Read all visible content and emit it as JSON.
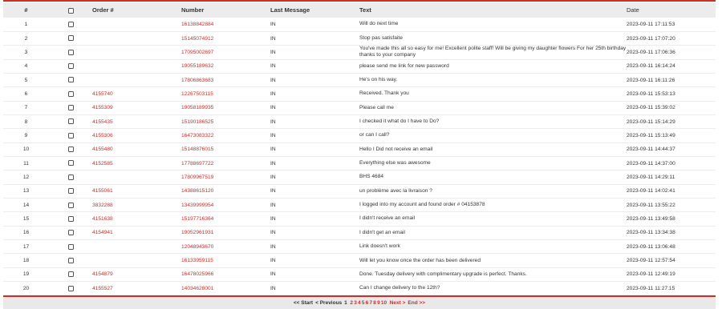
{
  "columns": {
    "num": "#",
    "order": "Order #",
    "number": "Number",
    "last_message": "Last Message",
    "text": "Text",
    "date": "Date"
  },
  "rows": [
    {
      "num": "1",
      "order": "",
      "number": "16138842884",
      "last": "IN",
      "text": "Will do next time",
      "date": "2023-09-11 17:11:53"
    },
    {
      "num": "2",
      "order": "",
      "number": "15145074912",
      "last": "IN",
      "text": "Stop pas satisfaite",
      "date": "2023-09-11 17:07:20"
    },
    {
      "num": "3",
      "order": "",
      "number": "17095002697",
      "last": "IN",
      "text": "You've made this all so easy for me! Excellent polite staff! Will be giving my daughter flowers For her 25th birthday thanks to your company",
      "date": "2023-09-11 17:06:36"
    },
    {
      "num": "4",
      "order": "",
      "number": "19055189632",
      "last": "IN",
      "text": "please send me link for new password",
      "date": "2023-09-11 16:14:24"
    },
    {
      "num": "5",
      "order": "",
      "number": "17806863683",
      "last": "IN",
      "text": "He's on his way.",
      "date": "2023-09-11 16:11:26"
    },
    {
      "num": "6",
      "order": "4155740",
      "number": "12267503115",
      "last": "IN",
      "text": "Received. Thank you",
      "date": "2023-09-11 15:53:13"
    },
    {
      "num": "7",
      "order": "4155309",
      "number": "19058189935",
      "last": "IN",
      "text": "Please call me",
      "date": "2023-09-11 15:39:02"
    },
    {
      "num": "8",
      "order": "4155435",
      "number": "15190186525",
      "last": "IN",
      "text": "I checked it what do I have to Do?",
      "date": "2023-09-11 15:14:29"
    },
    {
      "num": "9",
      "order": "4155306",
      "number": "16473083322",
      "last": "IN",
      "text": "or can I call?",
      "date": "2023-09-11 15:13:49"
    },
    {
      "num": "10",
      "order": "4155480",
      "number": "15148876015",
      "last": "IN",
      "text": "Hello I Did not receive an email",
      "date": "2023-09-11 14:44:37"
    },
    {
      "num": "11",
      "order": "4152585",
      "number": "17788697722",
      "last": "IN",
      "text": "Everything else was awesome",
      "date": "2023-09-11 14:37:00"
    },
    {
      "num": "12",
      "order": "",
      "number": "17809967519",
      "last": "IN",
      "text": "BHS 4684",
      "date": "2023-09-11 14:29:11"
    },
    {
      "num": "13",
      "order": "4155061",
      "number": "14388615120",
      "last": "IN",
      "text": "un problème avec la livraison ?",
      "date": "2023-09-11 14:02:41"
    },
    {
      "num": "14",
      "order": "3832288",
      "number": "13439999954",
      "last": "IN",
      "text": "I logged into my account and found order # 04153878",
      "date": "2023-09-11 13:55:22"
    },
    {
      "num": "15",
      "order": "4151638",
      "number": "15197716364",
      "last": "IN",
      "text": "I didn't receive an email",
      "date": "2023-09-11 13:49:58"
    },
    {
      "num": "16",
      "order": "4154941",
      "number": "19052961931",
      "last": "IN",
      "text": "I didn't get an email",
      "date": "2023-09-11 13:34:38"
    },
    {
      "num": "17",
      "order": "",
      "number": "12048943670",
      "last": "IN",
      "text": "Link doesn't work",
      "date": "2023-09-11 13:06:48"
    },
    {
      "num": "18",
      "order": "",
      "number": "16133959115",
      "last": "IN",
      "text": "Will let you know once the order has been delivered",
      "date": "2023-09-11 12:57:54"
    },
    {
      "num": "19",
      "order": "4154879",
      "number": "16478025966",
      "last": "IN",
      "text": "Done. Tuesday delivery with complimentary upgrade is perfect. Thanks.",
      "date": "2023-09-11 12:49:19"
    },
    {
      "num": "20",
      "order": "4155527",
      "number": "14034628001",
      "last": "IN",
      "text": "Can I change delivery to the 12th?",
      "date": "2023-09-11 11:27:15"
    }
  ],
  "pagination": {
    "start": "<< Start",
    "previous": "< Previous",
    "current": "1",
    "pages": [
      "2",
      "3",
      "4",
      "5",
      "6",
      "7",
      "8",
      "9",
      "10"
    ],
    "next": "Next >",
    "end": "End >>"
  },
  "colors": {
    "accent": "#c9302c",
    "header_bg": "#ececec"
  }
}
